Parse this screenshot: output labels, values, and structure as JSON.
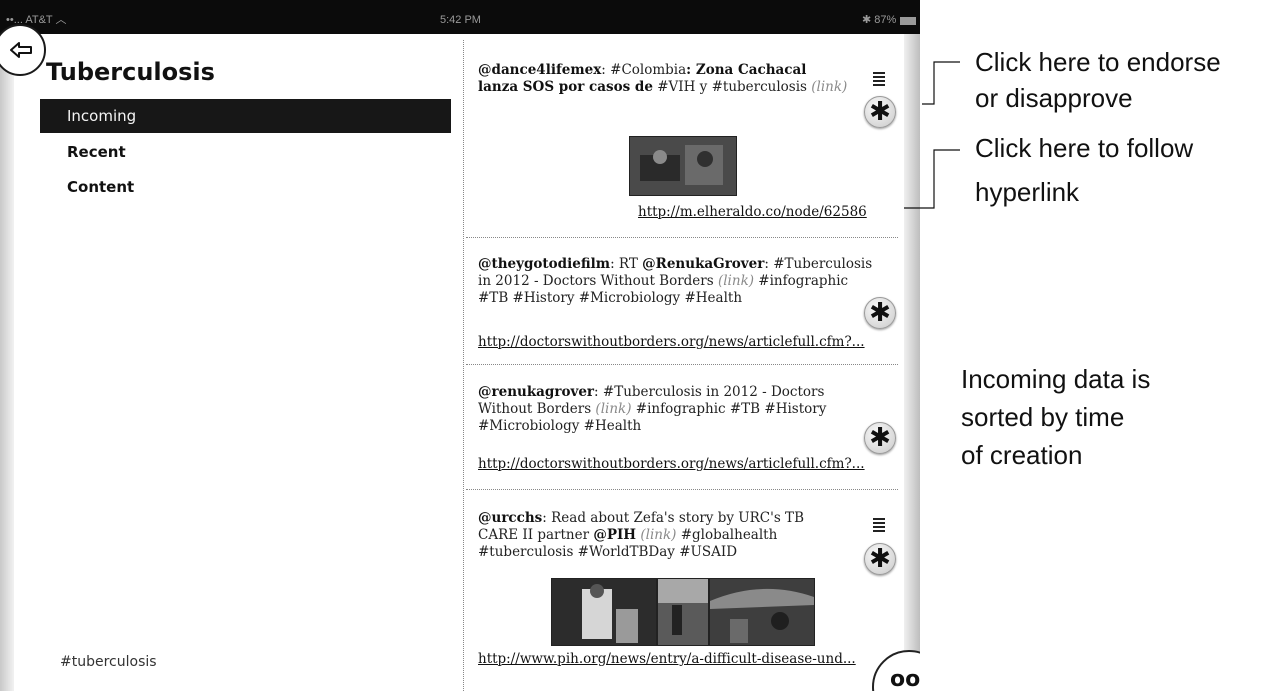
{
  "status_bar": {
    "carrier": "AT&T",
    "time": "5:42 PM",
    "battery": "87%"
  },
  "sidebar": {
    "title": "Tuberculosis",
    "items": [
      {
        "label": "Incoming",
        "active": true
      },
      {
        "label": "Recent",
        "active": false
      },
      {
        "label": "Content",
        "active": false
      }
    ],
    "footer_hashtag": "#tuberculosis"
  },
  "feed": {
    "tweets": [
      {
        "handle": "@dance4lifemex",
        "colon": ":",
        "body_1": " #Colombia",
        "body_bold": ": Zona Cachacal lanza SOS por casos de",
        "body_2": " #VIH y #tuberculosis ",
        "link_label": "(link)",
        "url": "http://m.elheraldo.co/node/62586"
      },
      {
        "handle": "@theygotodiefilm",
        "colon": ": RT ",
        "mention": "@RenukaGrover",
        "body_1": ": #Tuberculosis in 2012 - Doctors Without Borders ",
        "link_label": "(link)",
        "body_2": " #infographic #TB #History #Microbiology #Health",
        "url": "http://doctorswithoutborders.org/news/articlefull.cfm?..."
      },
      {
        "handle": "@renukagrover",
        "colon": ": #Tuberculosis",
        "body_1": " in 2012 - Doctors Without Borders ",
        "link_label": "(link)",
        "body_2": " #infographic #TB #History #Microbiology #Health",
        "url": "http://doctorswithoutborders.org/news/articlefull.cfm?..."
      },
      {
        "handle": "@urcchs",
        "colon": ": Read about Zefa's story by URC's TB CARE II partner ",
        "mention": "@PIH",
        "link_label": "(link)",
        "body_2": " #globalhealth #tuberculosis #WorldTBDay #USAID",
        "url": "http://www.pih.org/news/entry/a-difficult-disease-und..."
      }
    ],
    "corner_button_label": "oo"
  },
  "annotations": {
    "endorse": [
      "Click here to endorse",
      "or disapprove"
    ],
    "follow": [
      "Click here to follow",
      "hyperlink"
    ],
    "sorted": [
      "Incoming data is",
      "sorted by time",
      "of creation"
    ]
  },
  "icons": {
    "back": "back-arrow-icon",
    "menu": "menu-lines-icon",
    "endorse": "asterisk-icon"
  }
}
